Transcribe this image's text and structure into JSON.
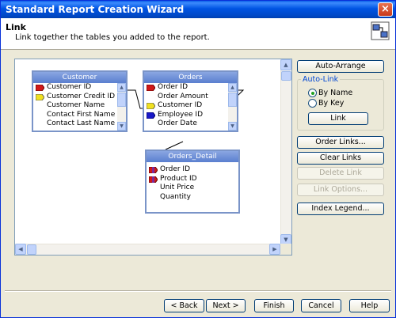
{
  "window": {
    "title": "Standard Report Creation Wizard",
    "close_glyph": "×"
  },
  "header": {
    "title": "Link",
    "subtitle": "Link together the tables you added to the report.",
    "icon": "link-tables-icon"
  },
  "tables": [
    {
      "name": "Customer",
      "fields": [
        {
          "label": "Customer ID",
          "key": "red"
        },
        {
          "label": "Customer Credit ID",
          "key": "yellow"
        },
        {
          "label": "Customer Name",
          "key": ""
        },
        {
          "label": "Contact First Name",
          "key": ""
        },
        {
          "label": "Contact Last Name",
          "key": ""
        }
      ]
    },
    {
      "name": "Orders",
      "fields": [
        {
          "label": "Order ID",
          "key": "red"
        },
        {
          "label": "Order Amount",
          "key": ""
        },
        {
          "label": "Customer ID",
          "key": "yellow"
        },
        {
          "label": "Employee ID",
          "key": "blue"
        },
        {
          "label": "Order Date",
          "key": ""
        }
      ]
    },
    {
      "name": "Orders_Detail",
      "fields": [
        {
          "label": "Order ID",
          "key": "red-purple"
        },
        {
          "label": "Product ID",
          "key": "red-purple"
        },
        {
          "label": "Unit Price",
          "key": ""
        },
        {
          "label": "Quantity",
          "key": ""
        }
      ]
    }
  ],
  "side": {
    "auto_arrange": "Auto-Arrange",
    "auto_link_title": "Auto-Link",
    "by_name": "By Name",
    "by_key": "By Key",
    "selected": "By Name",
    "link": "Link",
    "order_links": "Order Links...",
    "clear_links": "Clear Links",
    "delete_link": "Delete Link",
    "link_options": "Link Options...",
    "index_legend": "Index Legend..."
  },
  "footer": {
    "back": "< Back",
    "next": "Next >",
    "finish": "Finish",
    "cancel": "Cancel",
    "help": "Help"
  },
  "colors": {
    "titlebar": "#0054e3",
    "key_red": "#d01818",
    "key_yellow": "#f0e020",
    "key_blue": "#1818c8",
    "accent": "#0046d5"
  }
}
